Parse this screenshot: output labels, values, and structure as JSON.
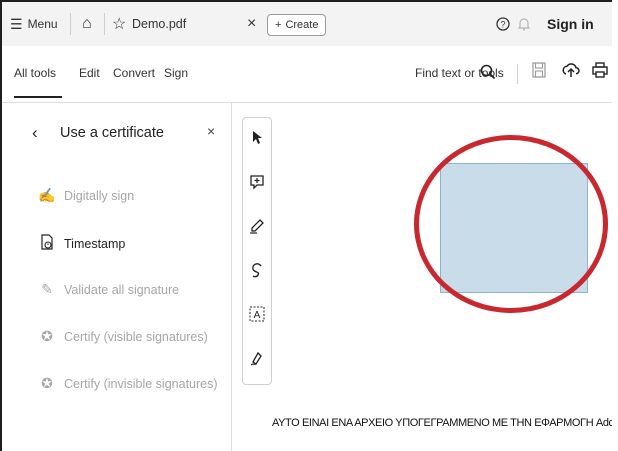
{
  "topbar": {
    "menu_label": "Menu",
    "tab_title": "Demo.pdf",
    "create_label": "Create",
    "signin_label": "Sign in",
    "icons": [
      "hamburger-icon",
      "home-icon",
      "star-icon",
      "close-icon",
      "plus-icon",
      "help-icon",
      "bell-icon"
    ]
  },
  "toolbar": {
    "tabs": [
      {
        "label": "All tools"
      },
      {
        "label": "Edit"
      },
      {
        "label": "Convert"
      },
      {
        "label": "Sign"
      }
    ],
    "find_label": "Find text or tools",
    "icons": [
      "search-icon",
      "save-icon",
      "upload-icon",
      "print-icon"
    ]
  },
  "panel": {
    "title": "Use a certificate",
    "items": [
      {
        "label": "Digitally sign",
        "enabled": false
      },
      {
        "label": "Timestamp",
        "enabled": true
      },
      {
        "label": "Validate all signature",
        "enabled": false
      },
      {
        "label": "Certify (visible signatures)",
        "enabled": false
      },
      {
        "label": "Certify (invisible signatures)",
        "enabled": false
      }
    ]
  },
  "side_tools": [
    "cursor-icon",
    "add-comment-icon",
    "highlight-pen-icon",
    "freehand-draw-icon",
    "text-select-icon",
    "sign-pen-icon"
  ],
  "document": {
    "body_text": "ΑΥΤΟ ΕΙΝΑΙ ΕΝΑ ΑΡΧΕΙΟ ΥΠΟΓΕΓΡΑΜΜΕΝΟ ΜΕ ΤΗΝ ΕΦΑΡΜΟΓΗ Adobe Read"
  },
  "colors": {
    "signature_box": "#c8dde9",
    "highlight_circle": "#c8282e"
  }
}
